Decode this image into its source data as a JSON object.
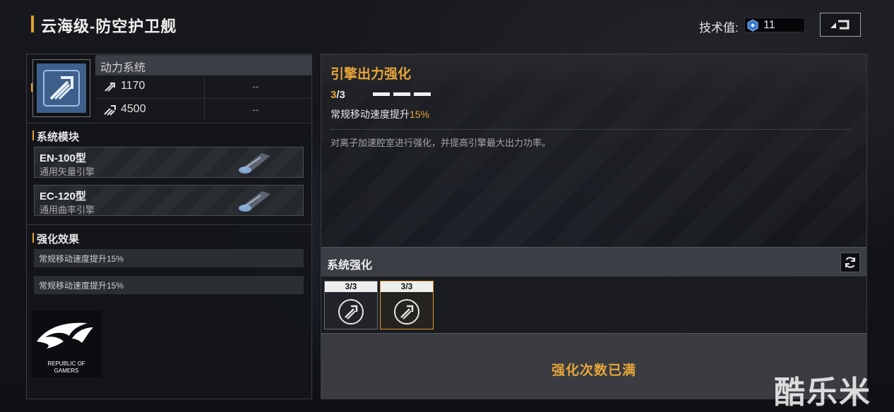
{
  "header": {
    "title": "云海级-防空护卫舰",
    "tech_label": "技术值:",
    "tech_value": "11",
    "return_icon": "return-arrow-icon"
  },
  "system": {
    "name": "动力系统",
    "icon": "thruster-system-icon",
    "stats": [
      {
        "icon": "speed-arrow-icon",
        "value": "1170",
        "secondary": "--"
      },
      {
        "icon": "boost-arrow-icon",
        "value": "4500",
        "secondary": "--"
      }
    ]
  },
  "modules": {
    "title": "系统模块",
    "items": [
      {
        "name": "EN-100型",
        "sub": "通用矢量引擎"
      },
      {
        "name": "EC-120型",
        "sub": "通用曲率引擎"
      }
    ]
  },
  "effects": {
    "title": "强化效果",
    "items": [
      "常规移动速度提升15%",
      "常规移动速度提升15%"
    ]
  },
  "logo": {
    "name": "rog-logo",
    "text": "REPUBLIC OF GAMERS"
  },
  "detail": {
    "title": "引擎出力强化",
    "level_current": "3",
    "level_text": "/3",
    "level_bars": 3,
    "effect_prefix": "常规移动速度提升",
    "effect_value": "15%",
    "description": "对离子加速腔室进行强化，并提高引擎最大出力功率。"
  },
  "enhance": {
    "title": "系统强化",
    "refresh_icon": "refresh-icon",
    "slots": [
      {
        "count": "3/3",
        "selected": false,
        "icon": "thruster-upgrade-icon"
      },
      {
        "count": "3/3",
        "selected": true,
        "icon": "thruster-upgrade-icon"
      }
    ],
    "maxed_text": "强化次数已满"
  },
  "watermark": "酷乐米",
  "colors": {
    "accent": "#e7a53a",
    "system_icon_bg": "#3d5f8a"
  }
}
